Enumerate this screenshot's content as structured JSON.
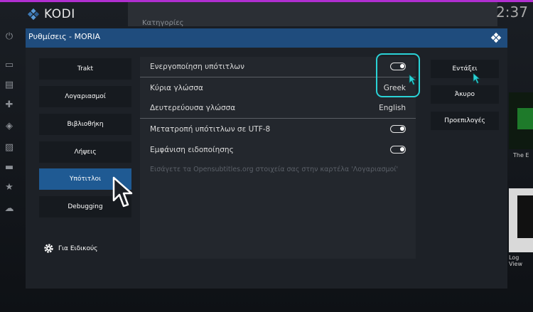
{
  "app": {
    "name": "KODI",
    "clock": "2:37"
  },
  "background": {
    "category_text": "Κατηγορίες",
    "right_caption_1": "The E",
    "right_caption_2": "Log View"
  },
  "dialog": {
    "title": "Ρυθμίσεις - MORIA",
    "categories": [
      {
        "label": "Trakt",
        "active": false
      },
      {
        "label": "Λογαριασμοί",
        "active": false
      },
      {
        "label": "Βιβλιοθήκη",
        "active": false
      },
      {
        "label": "Λήψεις",
        "active": false
      },
      {
        "label": "Υπότιτλοι",
        "active": true
      },
      {
        "label": "Debugging",
        "active": false
      }
    ],
    "expert_label": "Για Ειδικούς",
    "settings": {
      "enable_subtitles": {
        "label": "Ενεργοποίηση υπότιτλων",
        "on": true
      },
      "primary_language": {
        "label": "Κύρια γλώσσα",
        "value": "Greek"
      },
      "secondary_language": {
        "label": "Δευτερεύουσα γλώσσα",
        "value": "English"
      },
      "convert_utf8": {
        "label": "Μετατροπή υπότιτλων σε UTF-8",
        "on": true
      },
      "show_notification": {
        "label": "Εμφάνιση ειδοποίησης",
        "on": true
      },
      "hint": "Εισάγετε τα Opensubtitles.org στοιχεία σας στην καρτέλα 'Λογαριασμοί'"
    },
    "buttons": {
      "ok": "Εντάξει",
      "cancel": "Άκυρο",
      "defaults": "Προεπιλογές"
    }
  },
  "colors": {
    "accent": "#1f5a93",
    "titlebar": "#1f4c7d",
    "highlight": "#2ad2d6",
    "topline": "#b02fd0"
  }
}
